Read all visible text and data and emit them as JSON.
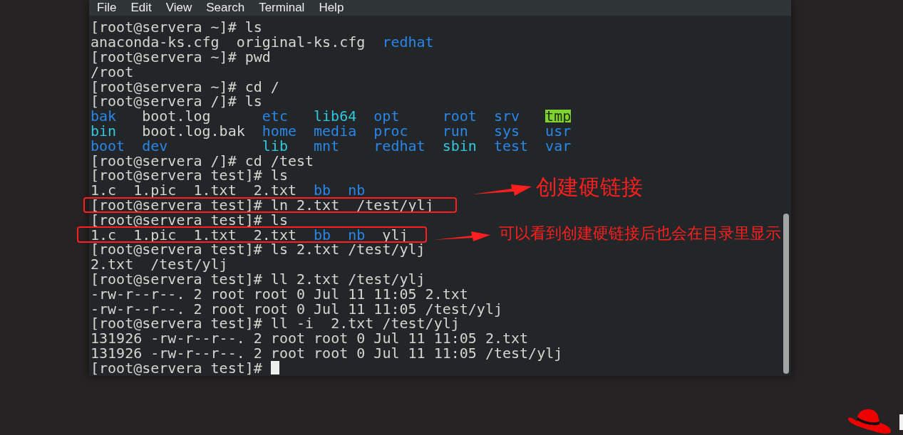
{
  "menu": [
    "File",
    "Edit",
    "View",
    "Search",
    "Terminal",
    "Help"
  ],
  "lines": [
    {
      "kind": "command",
      "prompt": "[root@servera ~]#",
      "command": "ls"
    },
    {
      "kind": "listing",
      "rows": [
        [
          {
            "name": "anaconda-ks.cfg",
            "kind": "file"
          },
          {
            "name": "original-ks.cfg",
            "kind": "file"
          },
          {
            "name": "redhat",
            "kind": "dir"
          }
        ]
      ]
    },
    {
      "kind": "command",
      "prompt": "[root@servera ~]#",
      "command": "pwd"
    },
    {
      "kind": "output",
      "text": "/root"
    },
    {
      "kind": "command",
      "prompt": "[root@servera ~]#",
      "command": "cd /"
    },
    {
      "kind": "command",
      "prompt": "[root@servera /]#",
      "command": "ls"
    },
    {
      "kind": "listing",
      "rows": [
        [
          {
            "name": "bak",
            "kind": "dir"
          },
          {
            "name": "boot.log",
            "kind": "file"
          },
          {
            "name": "etc",
            "kind": "dir"
          },
          {
            "name": "lib64",
            "kind": "link"
          },
          {
            "name": "opt",
            "kind": "dir"
          },
          {
            "name": "root",
            "kind": "dir"
          },
          {
            "name": "srv",
            "kind": "dir"
          },
          {
            "name": "tmp",
            "kind": "sticky"
          }
        ],
        [
          {
            "name": "bin",
            "kind": "link"
          },
          {
            "name": "boot.log.bak",
            "kind": "file"
          },
          {
            "name": "home",
            "kind": "dir"
          },
          {
            "name": "media",
            "kind": "dir"
          },
          {
            "name": "proc",
            "kind": "dir"
          },
          {
            "name": "run",
            "kind": "dir"
          },
          {
            "name": "sys",
            "kind": "dir"
          },
          {
            "name": "usr",
            "kind": "dir"
          }
        ],
        [
          {
            "name": "boot",
            "kind": "dir"
          },
          {
            "name": "dev",
            "kind": "dir"
          },
          {
            "name": "lib",
            "kind": "link"
          },
          {
            "name": "mnt",
            "kind": "dir"
          },
          {
            "name": "redhat",
            "kind": "dir"
          },
          {
            "name": "sbin",
            "kind": "link"
          },
          {
            "name": "test",
            "kind": "dir"
          },
          {
            "name": "var",
            "kind": "dir"
          }
        ]
      ]
    },
    {
      "kind": "command",
      "prompt": "[root@servera /]#",
      "command": "cd /test"
    },
    {
      "kind": "command",
      "prompt": "[root@servera test]#",
      "command": "ls"
    },
    {
      "kind": "listing",
      "rows": [
        [
          {
            "name": "1.c",
            "kind": "file"
          },
          {
            "name": "1.pic",
            "kind": "file"
          },
          {
            "name": "1.txt",
            "kind": "file"
          },
          {
            "name": "2.txt",
            "kind": "file"
          },
          {
            "name": "bb",
            "kind": "dir"
          },
          {
            "name": "nb",
            "kind": "dir"
          }
        ]
      ]
    },
    {
      "kind": "command",
      "prompt": "[root@servera test]#",
      "command": "ln 2.txt  /test/ylj"
    },
    {
      "kind": "command",
      "prompt": "[root@servera test]#",
      "command": "ls"
    },
    {
      "kind": "listing",
      "rows": [
        [
          {
            "name": "1.c",
            "kind": "file"
          },
          {
            "name": "1.pic",
            "kind": "file"
          },
          {
            "name": "1.txt",
            "kind": "file"
          },
          {
            "name": "2.txt",
            "kind": "file"
          },
          {
            "name": "bb",
            "kind": "dir"
          },
          {
            "name": "nb",
            "kind": "dir"
          },
          {
            "name": "ylj",
            "kind": "file"
          }
        ]
      ]
    },
    {
      "kind": "command",
      "prompt": "[root@servera test]#",
      "command": "ls 2.txt /test/ylj"
    },
    {
      "kind": "listing",
      "rows": [
        [
          {
            "name": "2.txt",
            "kind": "file"
          },
          {
            "name": "/test/ylj",
            "kind": "file"
          }
        ]
      ]
    },
    {
      "kind": "command",
      "prompt": "[root@servera test]#",
      "command": "ll 2.txt /test/ylj"
    },
    {
      "kind": "output",
      "text": "-rw-r--r--. 2 root root 0 Jul 11 11:05 2.txt"
    },
    {
      "kind": "output",
      "text": "-rw-r--r--. 2 root root 0 Jul 11 11:05 /test/ylj"
    },
    {
      "kind": "command",
      "prompt": "[root@servera test]#",
      "command": "ll -i  2.txt /test/ylj"
    },
    {
      "kind": "output",
      "text": "131926 -rw-r--r--. 2 root root 0 Jul 11 11:05 2.txt"
    },
    {
      "kind": "output",
      "text": "131926 -rw-r--r--. 2 root root 0 Jul 11 11:05 /test/ylj"
    },
    {
      "kind": "command",
      "prompt": "[root@servera test]#",
      "cursor": true
    }
  ],
  "annotations": [
    {
      "text": "创建硬链接"
    },
    {
      "text": "可以看到创建硬链接后也会在目录里显示"
    }
  ]
}
